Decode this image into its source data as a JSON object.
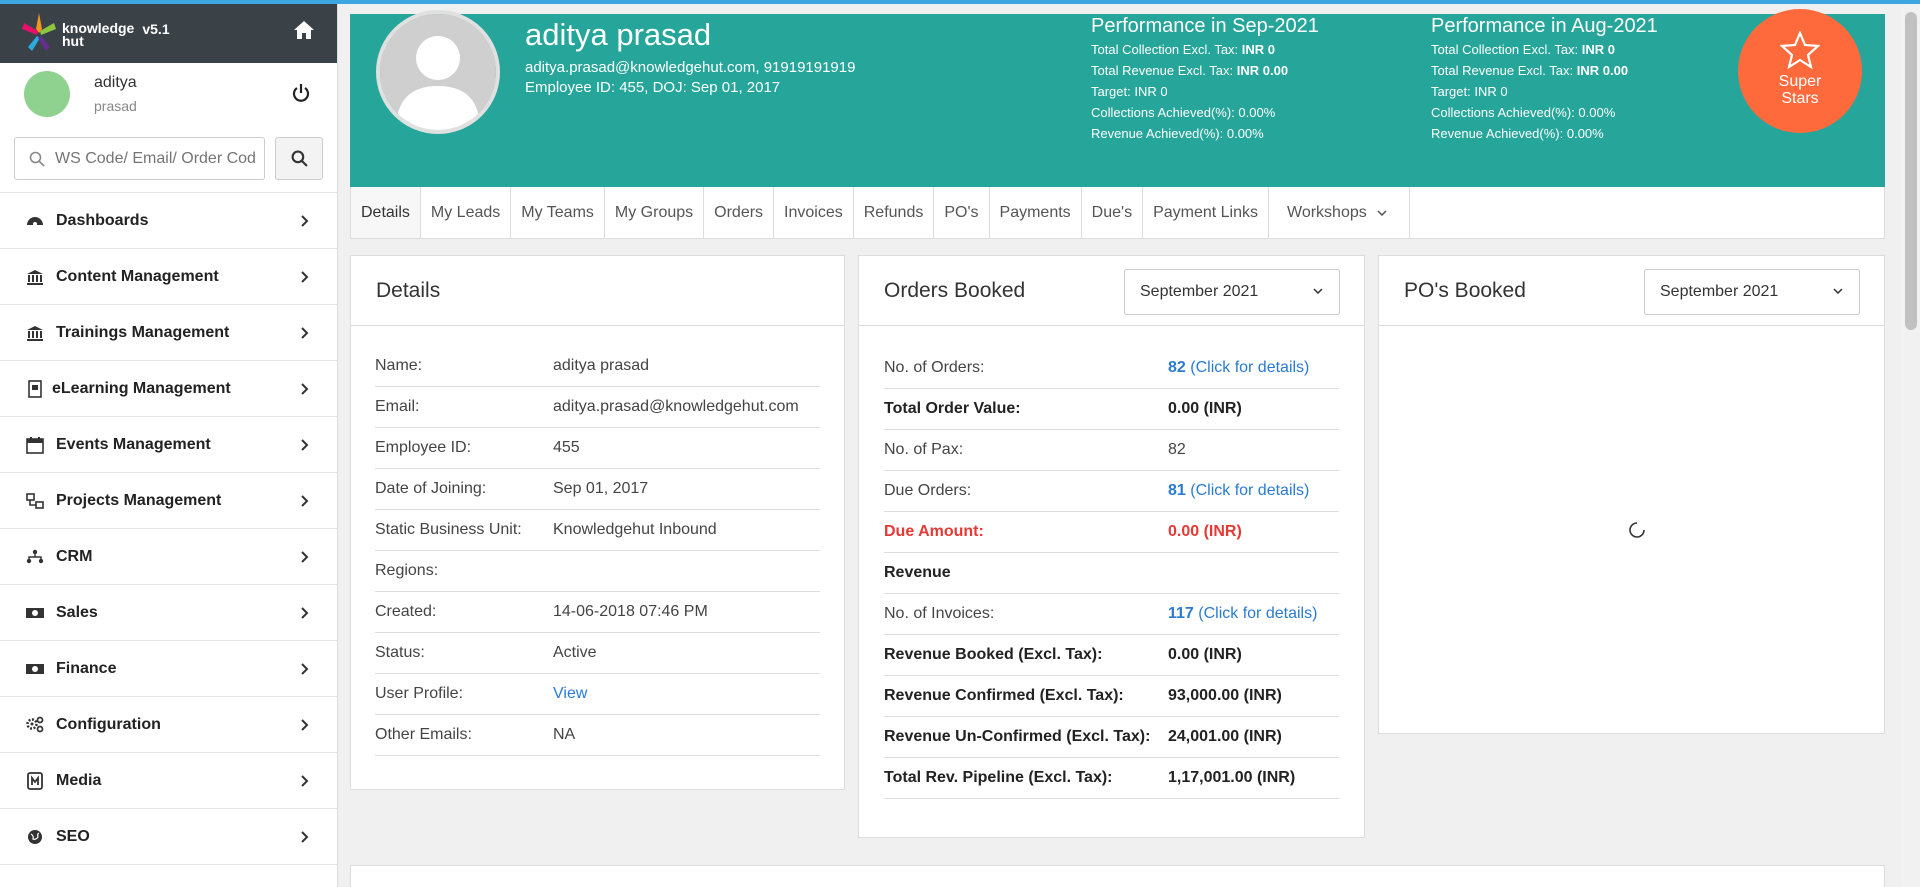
{
  "brand": {
    "name_line1": "knowledge",
    "name_line2": "hut",
    "version": "v5.1"
  },
  "user": {
    "first_name": "aditya",
    "last_name": "prasad"
  },
  "search": {
    "placeholder": "WS Code/ Email/ Order Code"
  },
  "sidebar": {
    "items": [
      {
        "label": "Dashboards",
        "icon": "dashboard-icon"
      },
      {
        "label": "Content Management",
        "icon": "bank-icon"
      },
      {
        "label": "Trainings Management",
        "icon": "bank-icon"
      },
      {
        "label": "eLearning Management",
        "icon": "elearning-icon"
      },
      {
        "label": "Events Management",
        "icon": "calendar-icon"
      },
      {
        "label": "Projects Management",
        "icon": "project-icon"
      },
      {
        "label": "CRM",
        "icon": "crm-icon"
      },
      {
        "label": "Sales",
        "icon": "money-icon"
      },
      {
        "label": "Finance",
        "icon": "money-icon"
      },
      {
        "label": "Configuration",
        "icon": "cogs-icon"
      },
      {
        "label": "Media",
        "icon": "media-icon"
      },
      {
        "label": "SEO",
        "icon": "globe-icon"
      }
    ]
  },
  "profile": {
    "name": "aditya prasad",
    "contact": "aditya.prasad@knowledgehut.com, 91919191919",
    "employee": "Employee ID: 455, DOJ: Sep 01, 2017"
  },
  "performance": [
    {
      "title": "Performance in Sep-2021",
      "collection_label": "Total Collection Excl. Tax:",
      "collection_value": "INR 0",
      "revenue_label": "Total Revenue Excl. Tax:",
      "revenue_value": "INR 0.00",
      "target": "Target: INR 0",
      "collections_achieved": "Collections Achieved(%): 0.00%",
      "revenue_achieved": "Revenue Achieved(%): 0.00%"
    },
    {
      "title": "Performance in Aug-2021",
      "collection_label": "Total Collection Excl. Tax:",
      "collection_value": "INR 0",
      "revenue_label": "Total Revenue Excl. Tax:",
      "revenue_value": "INR 0.00",
      "target": "Target: INR 0",
      "collections_achieved": "Collections Achieved(%): 0.00%",
      "revenue_achieved": "Revenue Achieved(%): 0.00%"
    }
  ],
  "badge": {
    "line1": "Super",
    "line2": "Stars"
  },
  "tabs": [
    "Details",
    "My Leads",
    "My Teams",
    "My Groups",
    "Orders",
    "Invoices",
    "Refunds",
    "PO's",
    "Payments",
    "Due's",
    "Payment Links",
    "Workshops"
  ],
  "details": {
    "title": "Details",
    "rows": [
      {
        "label": "Name:",
        "value": "aditya prasad"
      },
      {
        "label": "Email:",
        "value": "aditya.prasad@knowledgehut.com"
      },
      {
        "label": "Employee ID:",
        "value": "455"
      },
      {
        "label": "Date of Joining:",
        "value": "Sep 01, 2017"
      },
      {
        "label": "Static Business Unit:",
        "value": "Knowledgehut Inbound"
      },
      {
        "label": "Regions:",
        "value": ""
      },
      {
        "label": "Created:",
        "value": "14-06-2018 07:46 PM"
      },
      {
        "label": "Status:",
        "value": "Active"
      },
      {
        "label": "User Profile:",
        "value": "View"
      },
      {
        "label": "Other Emails:",
        "value": "NA"
      }
    ]
  },
  "orders": {
    "title": "Orders Booked",
    "month": "September 2021",
    "orders_label": "No. of Orders:",
    "orders_count": "82",
    "orders_link": "(Click for details)",
    "total_value_label": "Total Order Value:",
    "total_value": "0.00 (INR)",
    "pax_label": "No. of Pax:",
    "pax": "82",
    "due_orders_label": "Due Orders:",
    "due_orders_count": "81",
    "due_orders_link": "(Click for details)",
    "due_amount_label": "Due Amount:",
    "due_amount": "0.00 (INR)",
    "revenue_heading": "Revenue",
    "invoices_label": "No. of Invoices:",
    "invoices_count": "117",
    "invoices_link": "(Click for details)",
    "rev_booked_label": "Revenue Booked (Excl. Tax):",
    "rev_booked": "0.00 (INR)",
    "rev_confirmed_label": "Revenue Confirmed (Excl. Tax):",
    "rev_confirmed": "93,000.00 (INR)",
    "rev_unconfirmed_label": "Revenue Un-Confirmed (Excl. Tax):",
    "rev_unconfirmed": "24,001.00 (INR)",
    "rev_pipeline_label": "Total Rev. Pipeline (Excl. Tax):",
    "rev_pipeline": "1,17,001.00 (INR)"
  },
  "pos": {
    "title": "PO's Booked",
    "month": "September 2021"
  },
  "colors": {
    "banner": "#26a69a",
    "badge": "#ff6a3d",
    "link": "#2a7bd1",
    "danger": "#e53935",
    "sidebar_header": "#3a4248"
  }
}
